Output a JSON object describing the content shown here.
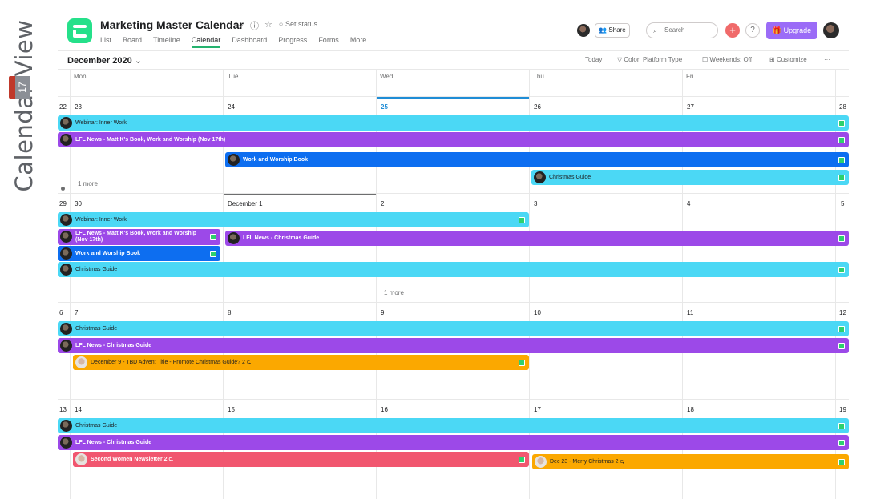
{
  "side": {
    "label": "Calendar View",
    "icon_day": "17"
  },
  "header": {
    "title": "Marketing Master Calendar",
    "set_status": "Set status",
    "tabs": [
      "List",
      "Board",
      "Timeline",
      "Calendar",
      "Dashboard",
      "Progress",
      "Forms",
      "More..."
    ],
    "active_tab": "Calendar",
    "share_label": "Share",
    "search_placeholder": "Search",
    "upgrade_label": "Upgrade"
  },
  "toolbar": {
    "month": "December 2020",
    "today": "Today",
    "color": "Color: Platform Type",
    "weekends": "Weekends: Off",
    "customize": "Customize"
  },
  "calendar": {
    "weekdays": [
      "Mon",
      "Tue",
      "Wed",
      "Thu",
      "Fri"
    ],
    "weeks": [
      {
        "weeknum": "22",
        "days": [
          "23",
          "24",
          "25",
          "26",
          "27"
        ],
        "next": "28"
      },
      {
        "weeknum": "29",
        "days": [
          "30",
          "December 1",
          "2",
          "3",
          "4"
        ],
        "next": "5"
      },
      {
        "weeknum": "6",
        "days": [
          "7",
          "8",
          "9",
          "10",
          "11"
        ],
        "next": "12"
      },
      {
        "weeknum": "13",
        "days": [
          "14",
          "15",
          "16",
          "17",
          "18"
        ],
        "next": "19"
      }
    ],
    "more": [
      "1 more",
      "1 more"
    ],
    "events": {
      "w1_webinar": "Webinar: Inner Work",
      "w1_lfl": "LFL News - Matt K's Book, Work and Worship (Nov 17th)",
      "w1_wwbook": "Work and Worship Book",
      "w1_christmas": "Christmas Guide",
      "w2_webinar": "Webinar: Inner Work",
      "w2_lfl1": "LFL News - Matt K's Book, Work and Worship",
      "w2_lfl1b": "(Nov 17th)",
      "w2_lfl2": "LFL News - Christmas Guide",
      "w2_wwbook": "Work and Worship Book",
      "w2_christmas": "Christmas Guide",
      "w3_christmas": "Christmas Guide",
      "w3_lfl": "LFL News - Christmas Guide",
      "w3_dec9": "December 9 - TBD Advent Title - Promote Christmas Guide? 2 ⮎",
      "w4_christmas": "Christmas Guide",
      "w4_lfl": "LFL News - Christmas Guide",
      "w4_women": "Second Women Newsletter 2 ⮎",
      "w4_dec23": "Dec 23 - Merry Christmas 2 ⮎"
    }
  }
}
